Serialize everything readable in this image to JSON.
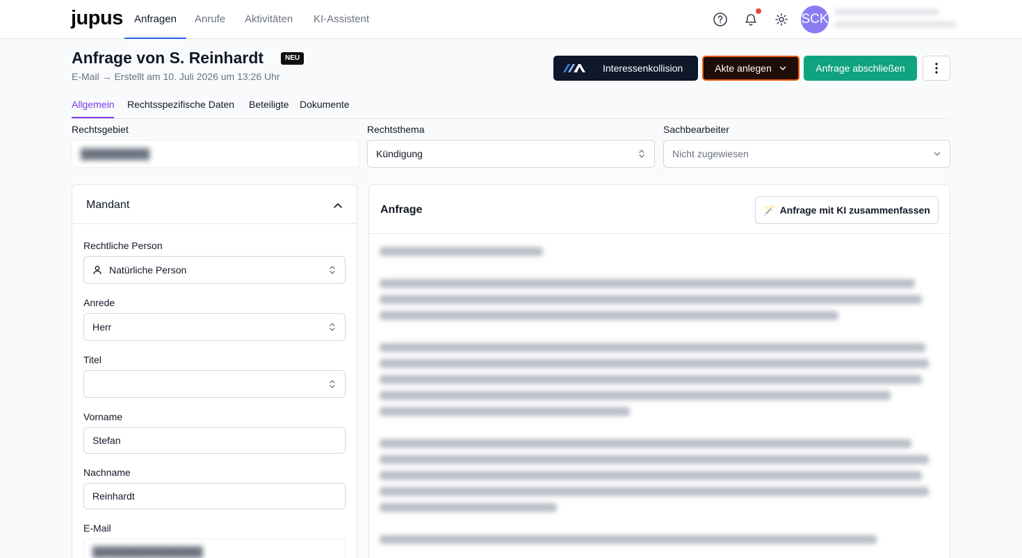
{
  "nav": {
    "logo": "jupus",
    "tabs": [
      "Anfragen",
      "Anrufe",
      "Aktivitäten",
      "KI-Assistent"
    ],
    "avatar_initials": "SCK",
    "accent": "#2563eb"
  },
  "header": {
    "title": "Anfrage von S. Reinhardt",
    "badge": "NEU",
    "subtitle": "E-Mail → Erstellt am 10. Juli 2026 um 13:26 Uhr",
    "btn_interessenkollision": "Interessenkollision",
    "btn_akte_anlegen": "Akte anlegen",
    "btn_abschliessen": "Anfrage abschließen"
  },
  "tabs": [
    "Allgemein",
    "Rechtsspezifische Daten",
    "Beteiligte",
    "Dokumente"
  ],
  "fields": {
    "rechtsgebiet_label": "Rechtsgebiet",
    "rechtsthema_label": "Rechtsthema",
    "rechtsthema_value": "Kündigung",
    "sachbearbeiter_label": "Sachbearbeiter",
    "sachbearbeiter_value": "Nicht zugewiesen"
  },
  "mandant": {
    "title": "Mandant",
    "rechtliche_person_label": "Rechtliche Person",
    "rechtliche_person_value": "Natürliche Person",
    "anrede_label": "Anrede",
    "anrede_value": "Herr",
    "titel_label": "Titel",
    "titel_value": "",
    "vorname_label": "Vorname",
    "vorname_value": "Stefan",
    "nachname_label": "Nachname",
    "nachname_value": "Reinhardt",
    "email_label": "E-Mail"
  },
  "anfrage": {
    "title": "Anfrage",
    "ki_button": "Anfrage mit KI zusammenfassen"
  },
  "colors": {
    "brand_purple": "#7c3aed",
    "green": "#10a37f",
    "orange_border": "#ea580c",
    "dark": "#0f172a"
  }
}
